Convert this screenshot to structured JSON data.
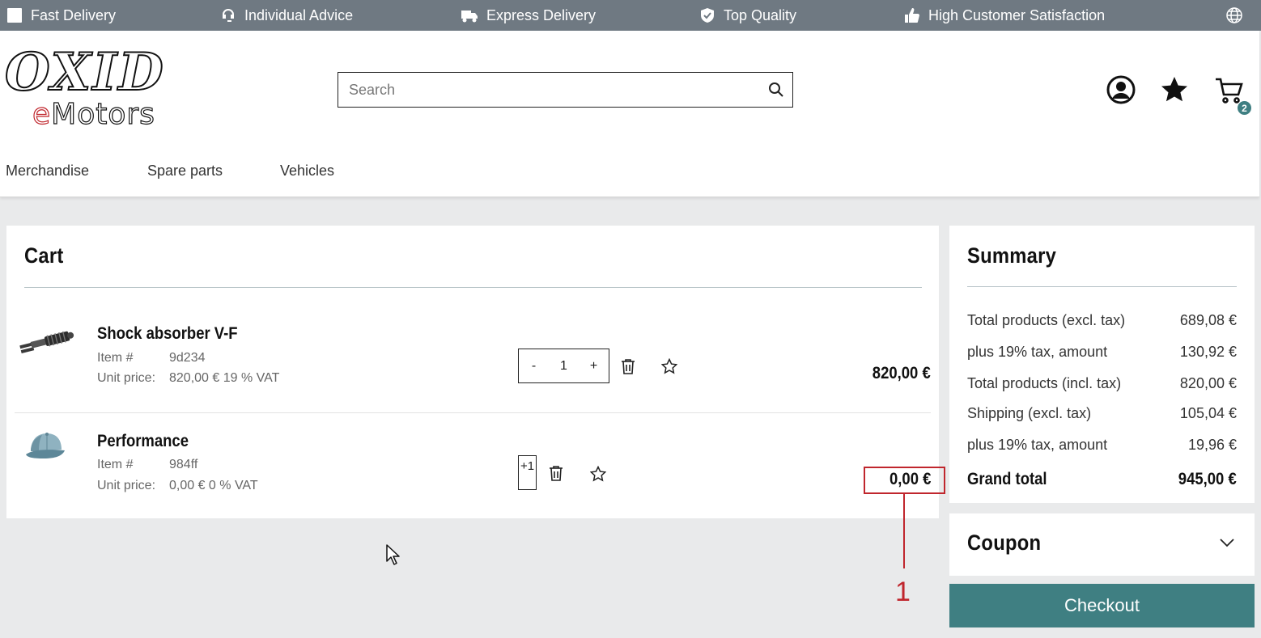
{
  "topbar": {
    "items": [
      "Fast Delivery",
      "Individual Advice",
      "Express Delivery",
      "Top Quality",
      "High Customer Satisfaction"
    ],
    "icons": [
      "box-icon",
      "headset-icon",
      "truck-icon",
      "shield-check-icon",
      "thumbs-up-icon",
      "globe-icon"
    ]
  },
  "logo": {
    "line1": "OXID",
    "line2_accent": "e",
    "line2_rest": "Motors"
  },
  "search": {
    "placeholder": "Search"
  },
  "header_icons": {
    "cart_count": "2"
  },
  "nav": [
    "Merchandise",
    "Spare parts",
    "Vehicles"
  ],
  "cart": {
    "title": "Cart",
    "item_label": "Item #",
    "unit_price_label": "Unit price:",
    "items": [
      {
        "name": "Shock absorber V-F",
        "item_no": "9d234",
        "unit_price": "820,00 € 19 % VAT",
        "qty": "1",
        "minus": "-",
        "plus": "+",
        "total": "820,00 €"
      },
      {
        "name": "Performance",
        "item_no": "984ff",
        "unit_price": "0,00 € 0 % VAT",
        "qty_label": "+1",
        "total": "0,00 €"
      }
    ]
  },
  "summary": {
    "title": "Summary",
    "rows": [
      {
        "label": "Total products (excl. tax)",
        "value": "689,08 €"
      },
      {
        "label": "plus 19% tax, amount",
        "value": "130,92 €"
      },
      {
        "label": "Total products (incl. tax)",
        "value": "820,00 €"
      },
      {
        "label": "Shipping (excl. tax)",
        "value": "105,04 €"
      },
      {
        "label": "plus 19% tax, amount",
        "value": "19,96 €"
      }
    ],
    "grand_label": "Grand total",
    "grand_value": "945,00 €"
  },
  "coupon": {
    "title": "Coupon"
  },
  "checkout": {
    "label": "Checkout"
  },
  "annotation": {
    "number": "1",
    "color": "#c0262d"
  },
  "colors": {
    "topbar": "#6f7982",
    "accent": "#3f7f82",
    "background": "#e9eaeb"
  }
}
